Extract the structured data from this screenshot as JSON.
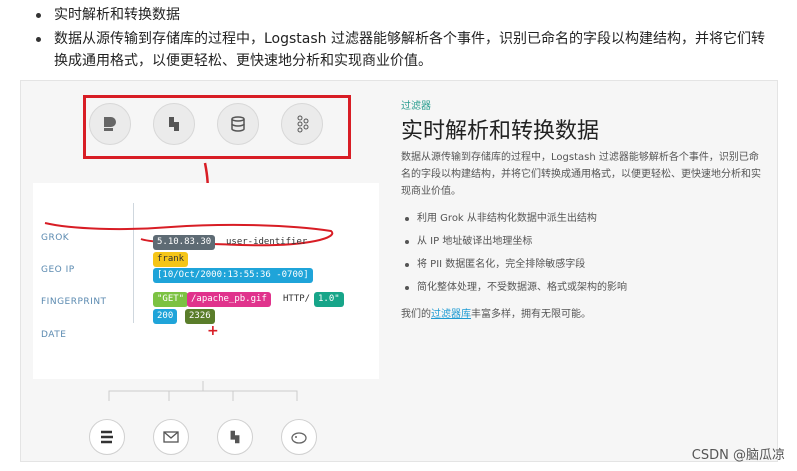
{
  "article": {
    "bullets": [
      "实时解析和转换数据",
      "数据从源传输到存储库的过程中，Logstash 过滤器能够解析各个事件，识别已命名的字段以构建结构，并将它们转换成通用格式，以便更轻松、更快速地分析和实现商业价值。"
    ]
  },
  "screenshot": {
    "eyebrow": "过滤器",
    "title": "实时解析和转换数据",
    "description": "数据从源传输到存储库的过程中，Logstash 过滤器能够解析各个事件，识别已命名的字段以构建结构，并将它们转换成通用格式，以便更轻松、更快速地分析和实现商业价值。",
    "features": [
      "利用 Grok 从非结构化数据中派生出结构",
      "从 IP 地址破译出地理坐标",
      "将 PII 数据匿名化，完全排除敏感字段",
      "简化整体处理，不受数据源、格式或架构的影响"
    ],
    "footer_prefix": "我们的",
    "footer_link": "过滤器库",
    "footer_suffix": "丰富多样，拥有无限可能。",
    "fields": [
      "GROK",
      "GEO IP",
      "FINGERPRINT",
      "DATE"
    ],
    "tags": {
      "ip": "5.10.83.30",
      "user": "user-identifier",
      "name": "frank",
      "timestamp": "[10/Oct/2000:13:55:36 -0700]",
      "method": "\"GET\"",
      "path": "/apache_pb.gif",
      "proto_prefix": "HTTP/",
      "proto_ver": "1.0\"",
      "status": "200",
      "size": "2326"
    },
    "top_icons": [
      "beats-icon",
      "logstash-icon",
      "database-icon",
      "kafka-icon"
    ],
    "bottom_icons": [
      "elasticsearch-icon",
      "mail-icon",
      "logstash-icon",
      "hadoop-icon"
    ]
  },
  "watermark": "CSDN @脑瓜凉",
  "colors": {
    "annotation_red": "#d81d25",
    "teal_accent": "#2a9d8f",
    "tag_gray": "#5e6b74",
    "tag_yellow": "#f5c518",
    "tag_blue": "#1fa4d9",
    "tag_green": "#7cc242",
    "tag_pink": "#e0338c",
    "tag_teal": "#17a589",
    "tag_darkgreen": "#5a7d2a"
  }
}
